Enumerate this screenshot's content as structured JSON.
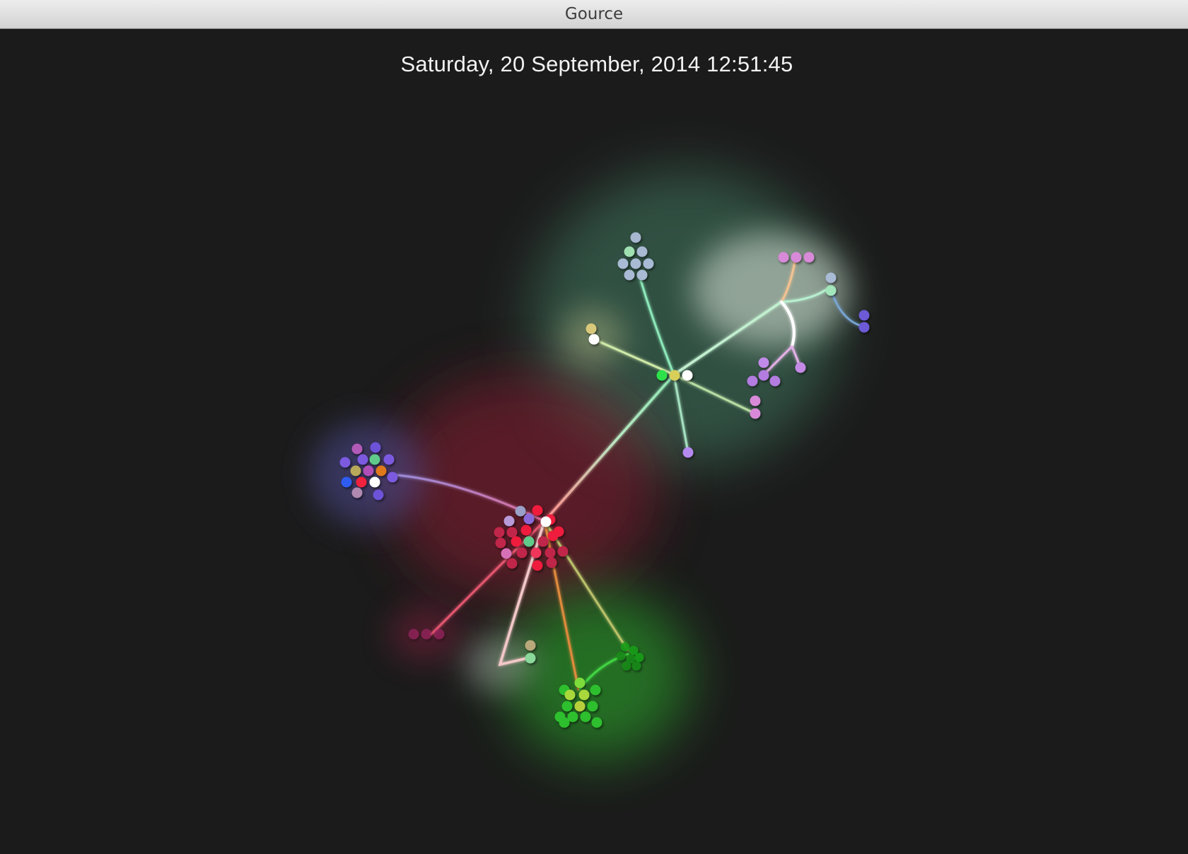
{
  "window": {
    "title": "Gource"
  },
  "visualization": {
    "date": "Saturday, 20 September, 2014 12:51:45",
    "colors": {
      "background": "#1b1b1b",
      "glow_green": "#5fb98a",
      "glow_red": "#a8263a",
      "glow_blue": "#6a67c8",
      "glow_bright_green": "#3de03d",
      "glow_white": "#e8ece0"
    }
  }
}
